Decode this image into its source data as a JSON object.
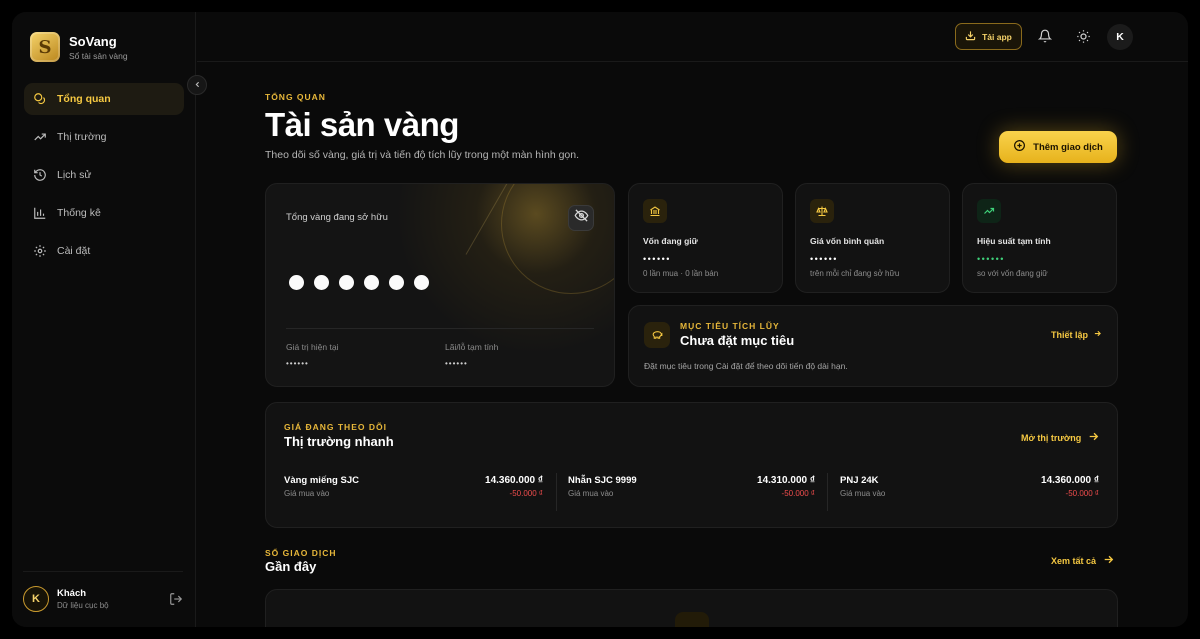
{
  "brand": {
    "name": "SoVang",
    "tagline": "Sổ tài sản vàng",
    "logo_letter": "S"
  },
  "sidebar": {
    "items": [
      {
        "label": "Tổng quan",
        "icon": "coins-icon",
        "active": true
      },
      {
        "label": "Thị trường",
        "icon": "trending-up-icon",
        "active": false
      },
      {
        "label": "Lịch sử",
        "icon": "history-icon",
        "active": false
      },
      {
        "label": "Thống kê",
        "icon": "bar-chart-icon",
        "active": false
      },
      {
        "label": "Cài đặt",
        "icon": "gear-icon",
        "active": false
      }
    ],
    "user": {
      "initial": "K",
      "name": "Khách",
      "sub": "Dữ liệu cục bộ"
    }
  },
  "topbar": {
    "download_label": "Tải app",
    "avatar_initial": "K"
  },
  "header": {
    "eyebrow": "TỔNG QUAN",
    "title": "Tài sản vàng",
    "subtitle": "Theo dõi số vàng, giá trị và tiến độ tích lũy trong một màn hình gọn.",
    "add_button": "Thêm giao dịch"
  },
  "hero": {
    "label": "Tổng vàng đang sở hữu",
    "stats": [
      {
        "label": "Giá trị hiện tại",
        "value": "••••••"
      },
      {
        "label": "Lãi/lỗ tạm tính",
        "value": "••••••"
      }
    ]
  },
  "stats": [
    {
      "label": "Vốn đang giữ",
      "value": "••••••",
      "sub": "0 lần mua · 0 lần bán",
      "icon": "bank-icon",
      "color": "#f5c842"
    },
    {
      "label": "Giá vốn bình quân",
      "value": "••••••",
      "sub": "trên mỗi chỉ đang sở hữu",
      "icon": "scale-icon",
      "color": "#f5c842"
    },
    {
      "label": "Hiệu suất tạm tính",
      "value": "••••••",
      "sub": "so với vốn đang giữ",
      "icon": "trending-up-icon",
      "color": "#3fd17a"
    }
  ],
  "goal": {
    "eyebrow": "MỤC TIÊU TÍCH LŨY",
    "title": "Chưa đặt mục tiêu",
    "subtitle": "Đặt mục tiêu trong Cài đặt để theo dõi tiến độ dài hạn.",
    "link": "Thiết lập"
  },
  "market": {
    "eyebrow": "GIÁ ĐANG THEO DÕI",
    "title": "Thị trường nhanh",
    "link": "Mở thị trường",
    "items": [
      {
        "name": "Vàng miếng SJC",
        "sub": "Giá mua vào",
        "price": "14.360.000 ₫",
        "change": "-50.000 ₫"
      },
      {
        "name": "Nhẫn SJC 9999",
        "sub": "Giá mua vào",
        "price": "14.310.000 ₫",
        "change": "-50.000 ₫"
      },
      {
        "name": "PNJ 24K",
        "sub": "Giá mua vào",
        "price": "14.360.000 ₫",
        "change": "-50.000 ₫"
      }
    ]
  },
  "recent": {
    "eyebrow": "SỔ GIAO DỊCH",
    "title": "Gần đây",
    "link": "Xem tất cả"
  },
  "colors": {
    "accent": "#f5c842",
    "negative": "#ef4c4c",
    "positive": "#3fd17a",
    "background": "#0a0a0a"
  }
}
